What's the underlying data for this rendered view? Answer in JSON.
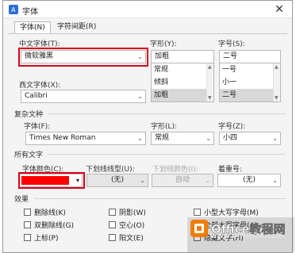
{
  "title": "字体",
  "tabs": [
    {
      "label": "字体(N)",
      "active": true
    },
    {
      "label": "字符间距(R)",
      "active": false
    }
  ],
  "chinese_font": {
    "label": "中文字体(T):",
    "value": "微软雅黑"
  },
  "style": {
    "label": "字形(Y):",
    "value": "加粗",
    "options": [
      "常规",
      "倾斜",
      "加粗"
    ],
    "selected": "加粗"
  },
  "size": {
    "label": "字号(S):",
    "value": "二号",
    "options": [
      "一号",
      "小一",
      "二号"
    ],
    "selected": "二号"
  },
  "western_font": {
    "label": "西文字体(X):",
    "value": "Calibri"
  },
  "complex": {
    "section_label": "复杂文种",
    "font_label": "字体(F):",
    "font_value": "Times New Roman",
    "style_label": "字形(L):",
    "style_value": "常规",
    "size_label": "字号(Z):",
    "size_value": "小四"
  },
  "all_text": {
    "section_label": "所有文字",
    "color_label": "字体颜色(C):",
    "color_value": "#ff0000",
    "underline_label": "下划线线型(U):",
    "underline_value": "(无)",
    "underline_color_label": "下划线颜色(I):",
    "underline_color_value": "自动",
    "emphasis_label": "着重号:",
    "emphasis_value": "(无)"
  },
  "effects": {
    "section_label": "效果",
    "col1": [
      "删除线(K)",
      "双删除线(G)",
      "上标(P)"
    ],
    "col2": [
      "阴影(W)",
      "空心(O)",
      "阳文(E)"
    ],
    "col3": [
      "小型大写字母(M)",
      "全部大写字母(A)",
      "隐藏文字(H)"
    ]
  },
  "watermark": {
    "brand": "Office教程网",
    "url": "www.office26.com"
  },
  "colors": {
    "highlight_red": "#d8001a",
    "brand_orange": "#f07d00"
  }
}
